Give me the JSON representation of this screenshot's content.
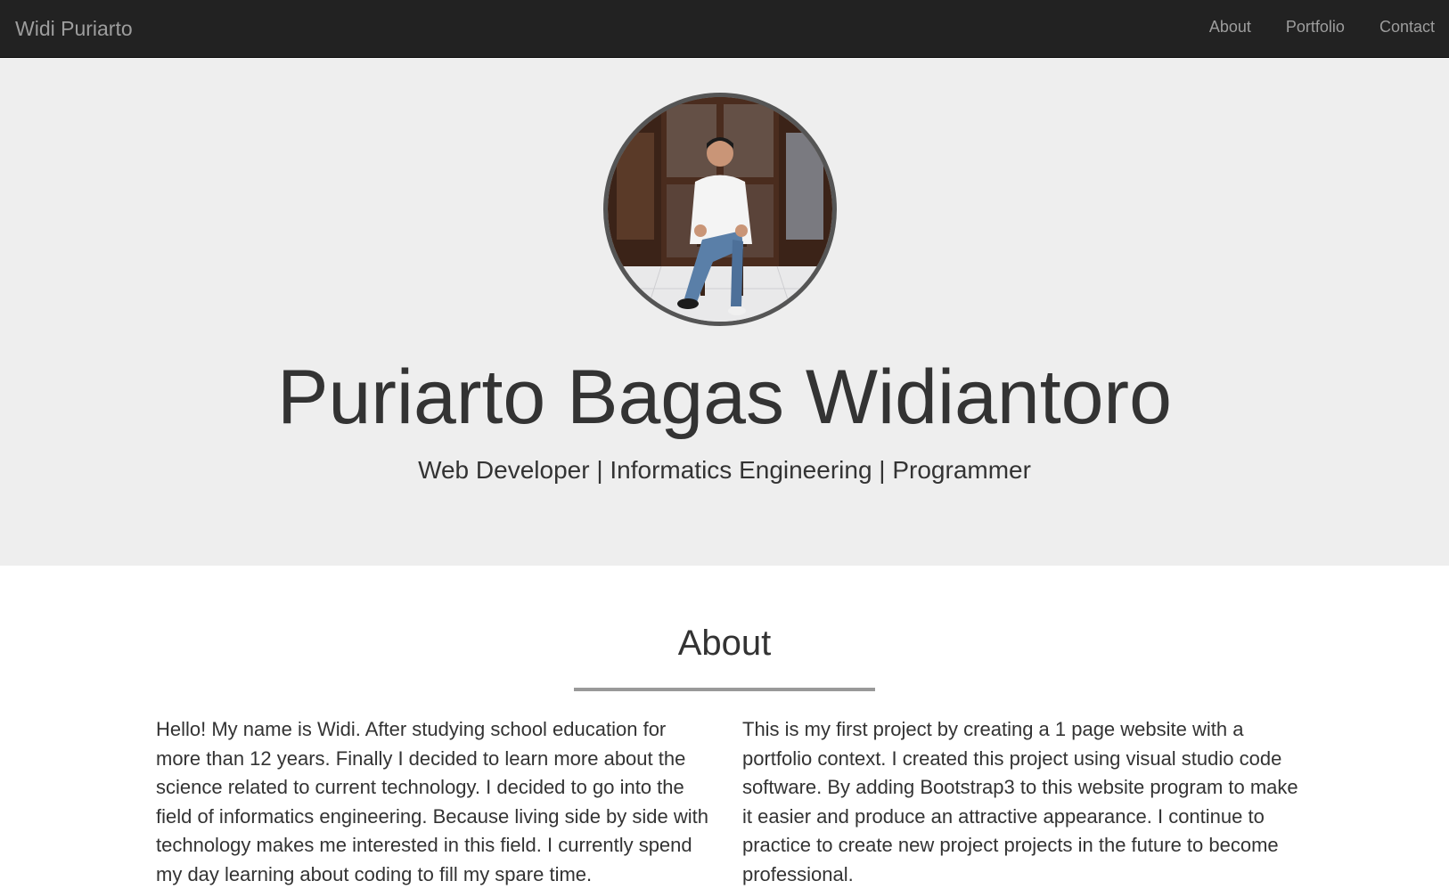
{
  "navbar": {
    "brand": "Widi Puriarto",
    "links": [
      {
        "label": "About"
      },
      {
        "label": "Portfolio"
      },
      {
        "label": "Contact"
      }
    ]
  },
  "hero": {
    "avatar_icon": "profile-photo",
    "name": "Puriarto Bagas Widiantoro",
    "subtitle": "Web Developer | Informatics Engineering | Programmer"
  },
  "about": {
    "title": "About",
    "left_text": "Hello! My name is Widi. After studying school education for more than 12 years. Finally I decided to learn more about the science related to current technology. I decided to go into the field of informatics engineering. Because living side by side with technology makes me interested in this field. I currently spend my day learning about coding to fill my spare time.",
    "right_text": "This is my first project by creating a 1 page website with a portfolio context. I created this project using visual studio code software. By adding Bootstrap3 to this website program to make it easier and produce an attractive appearance. I continue to practice to create new project projects in the future to become professional."
  },
  "colors": {
    "navbar_bg": "#222222",
    "navbar_text": "#9d9d9d",
    "jumbotron_bg": "#eeeeee",
    "text": "#333333",
    "avatar_border": "#555555"
  }
}
